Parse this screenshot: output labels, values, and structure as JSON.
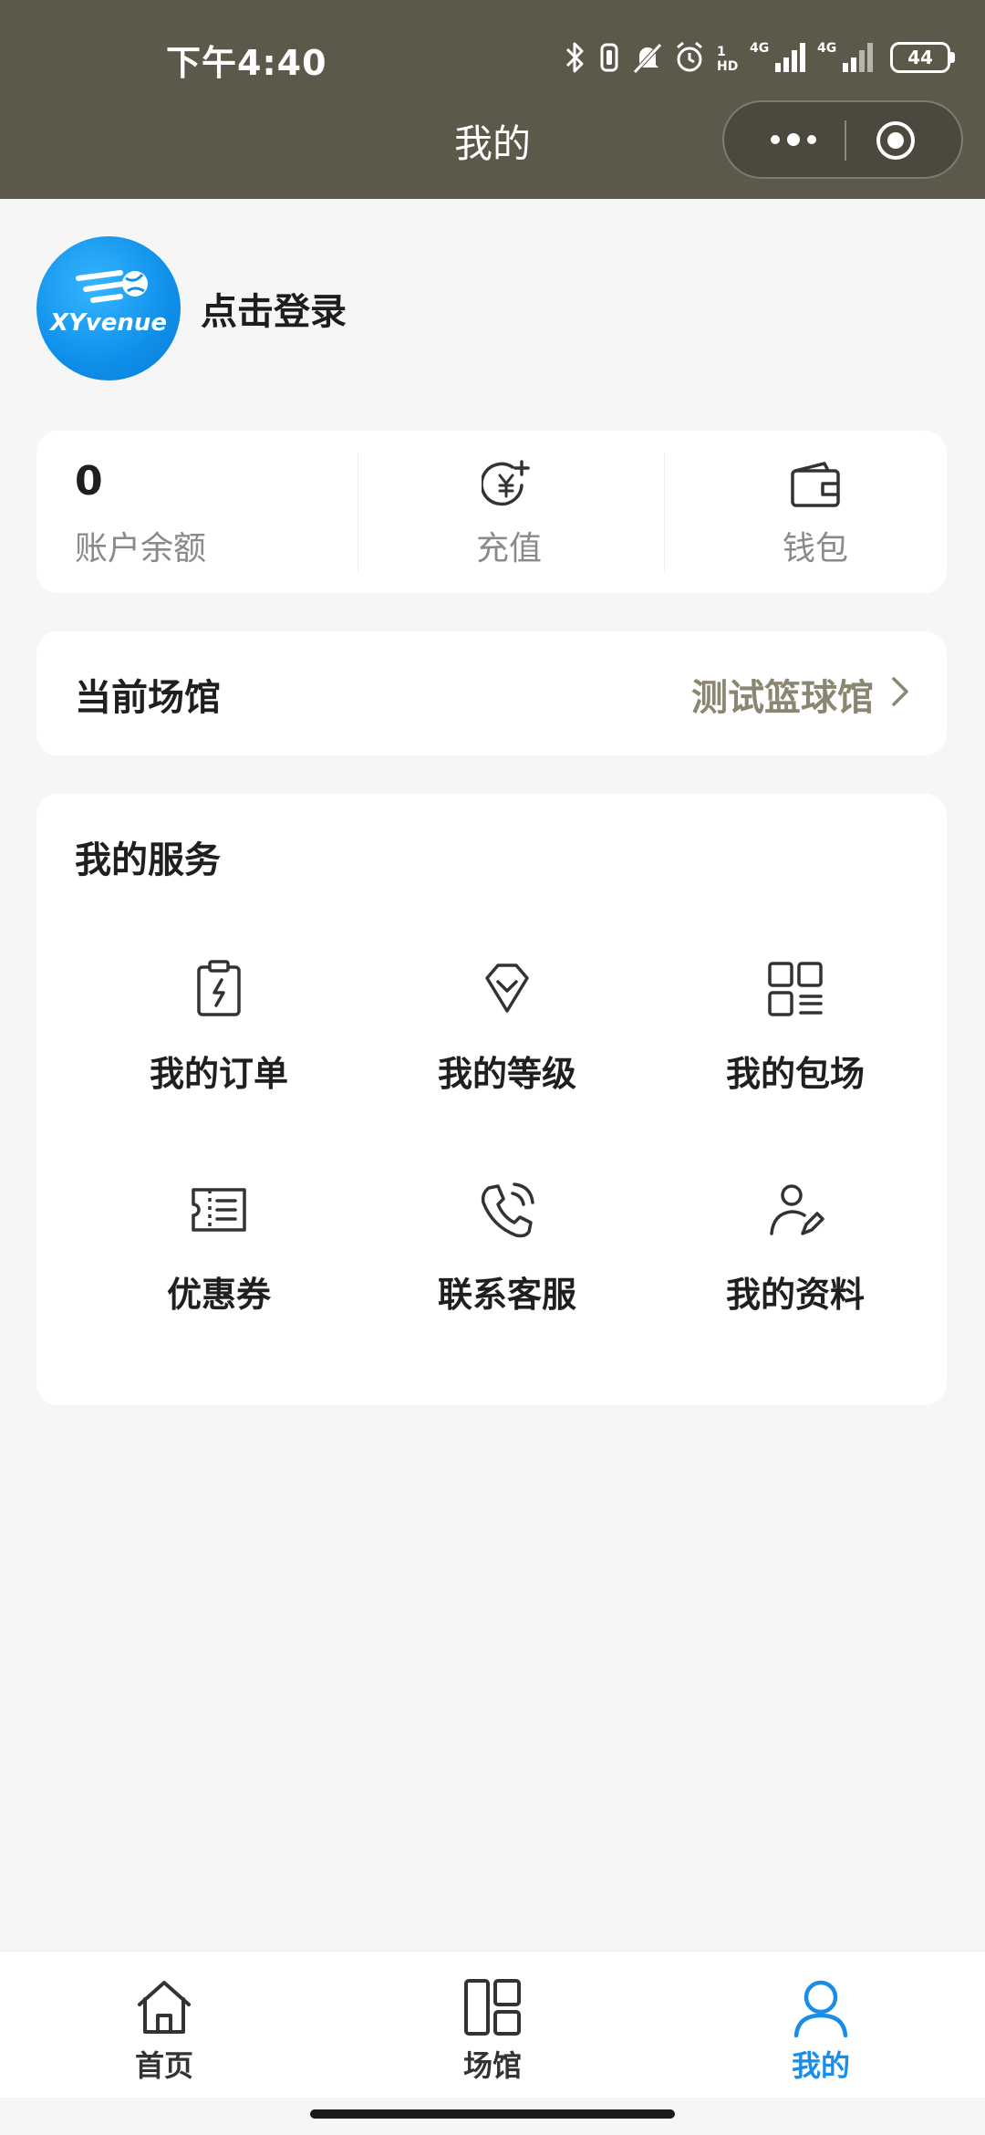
{
  "status_bar": {
    "time": "下午4:40",
    "battery": "44",
    "icons": [
      "bluetooth-icon",
      "vibrate-icon",
      "mute-icon",
      "alarm-icon",
      "hd-icon",
      "signal-4g-icon",
      "signal-4g-icon-2"
    ],
    "network_label_1": "4G",
    "network_label_2": "4G"
  },
  "header": {
    "title": "我的",
    "capsule_icons": [
      "more-dots-icon",
      "target-icon"
    ]
  },
  "profile": {
    "avatar_text": "XYvenue",
    "login_label": "点击登录"
  },
  "balance": {
    "value": "0",
    "label": "账户余额",
    "actions": [
      {
        "icon": "recharge-icon",
        "label": "充值"
      },
      {
        "icon": "wallet-icon",
        "label": "钱包"
      }
    ]
  },
  "venue": {
    "label": "当前场馆",
    "value": "测试篮球馆"
  },
  "services": {
    "title": "我的服务",
    "items": [
      {
        "icon": "order-icon",
        "label": "我的订单"
      },
      {
        "icon": "level-icon",
        "label": "我的等级"
      },
      {
        "icon": "booking-icon",
        "label": "我的包场"
      },
      {
        "icon": "coupon-icon",
        "label": "优惠券"
      },
      {
        "icon": "phone-icon",
        "label": "联系客服"
      },
      {
        "icon": "profile-icon",
        "label": "我的资料"
      }
    ]
  },
  "tabbar": {
    "items": [
      {
        "icon": "home-icon",
        "label": "首页"
      },
      {
        "icon": "venue-icon",
        "label": "场馆"
      },
      {
        "icon": "user-icon",
        "label": "我的"
      }
    ],
    "active_index": 2
  },
  "colors": {
    "header_bg": "#5c594b",
    "accent": "#1a8de6",
    "venue_value": "#8a8672",
    "page_bg": "#f6f6f6"
  }
}
